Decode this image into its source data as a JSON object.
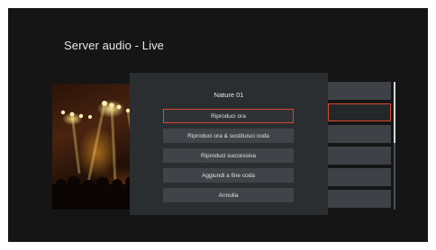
{
  "app": {
    "title": "Server audio - Live"
  },
  "album_art": {
    "icon": "concert-stage-photo"
  },
  "dialog": {
    "title": "Nature 01",
    "options": [
      {
        "label": "Riproduci ora",
        "focused": true
      },
      {
        "label": "Riproduci ora & sostituisci coda",
        "focused": false
      },
      {
        "label": "Riproduci successiva",
        "focused": false
      },
      {
        "label": "Aggiundi a fine coda",
        "focused": false
      },
      {
        "label": "Annulla",
        "focused": false
      }
    ]
  },
  "colors": {
    "screen_background": "#151515",
    "dialog_background": "#2b2e31",
    "button_background": "#404448",
    "focus_accent": "#d7482e",
    "text": "#e2e2e2"
  }
}
